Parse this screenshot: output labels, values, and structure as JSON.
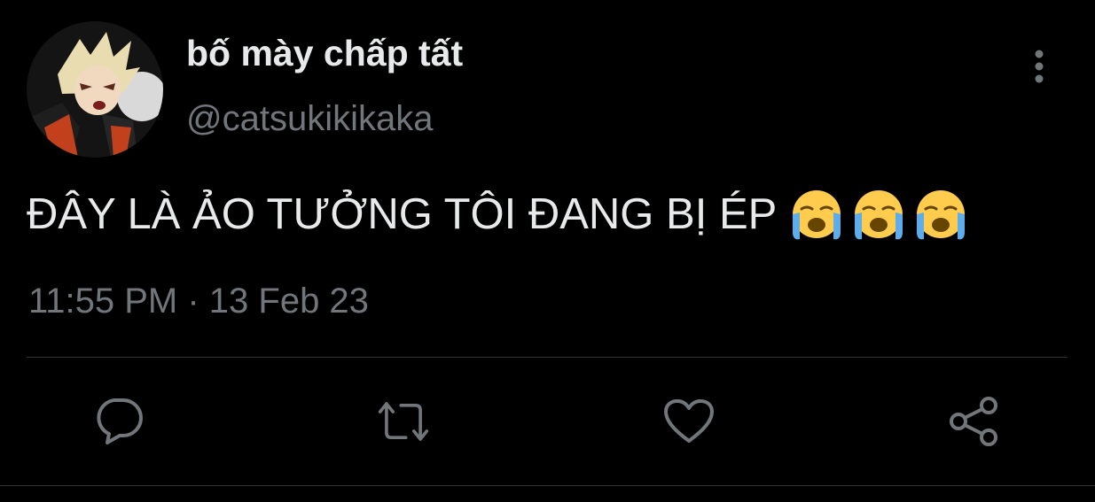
{
  "tweet": {
    "display_name": "bố mày chấp tất",
    "handle": "@catsukikikaka",
    "text": "ĐÂY LÀ ẢO TƯỞNG TÔI ĐANG BỊ ÉP",
    "emojis": [
      "loudly-crying-face-icon",
      "loudly-crying-face-icon",
      "loudly-crying-face-icon"
    ],
    "timestamp": "11:55 PM · 13 Feb 23"
  },
  "icons": {
    "more": "more-vertical-icon",
    "reply": "reply-icon",
    "retweet": "retweet-icon",
    "like": "heart-icon",
    "share": "share-icon"
  },
  "colors": {
    "background": "#000000",
    "primary_text": "#e7e9ea",
    "secondary_text": "#71767b",
    "divider": "#2f3336"
  }
}
